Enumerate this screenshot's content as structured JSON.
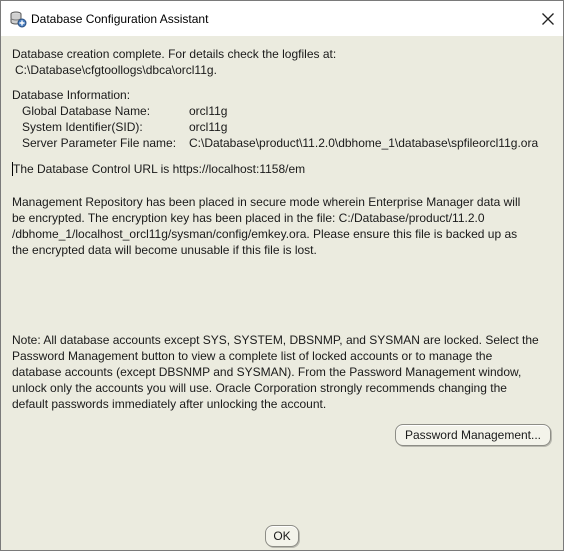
{
  "window": {
    "title": "Database Configuration Assistant",
    "icon": "database-config-icon",
    "close_icon": "close-icon"
  },
  "completion": {
    "line1": "Database creation complete. For details check the logfiles at:",
    "line2": "C:\\Database\\cfgtoollogs\\dbca\\orcl11g."
  },
  "db_info": {
    "heading": "Database Information:",
    "rows": [
      {
        "label": "Global Database Name:",
        "value": "orcl11g"
      },
      {
        "label": "System Identifier(SID):",
        "value": "orcl11g"
      },
      {
        "label": "Server Parameter File name:",
        "value": "C:\\Database\\product\\11.2.0\\dbhome_1\\database\\spfileorcl11g.ora"
      }
    ]
  },
  "control_url": "The Database Control URL is https://localhost:1158/em",
  "repository": {
    "lines": [
      "Management Repository has been placed in secure mode wherein Enterprise Manager data will",
      "be encrypted.  The encryption key has been placed in the file: C:/Database/product/11.2.0",
      "/dbhome_1/localhost_orcl11g/sysman/config/emkey.ora.   Please ensure this file is backed up as",
      "the encrypted data will become unusable if this file is lost."
    ]
  },
  "note": {
    "lines": [
      "Note: All database accounts except SYS, SYSTEM, DBSNMP, and SYSMAN are locked. Select the",
      "Password Management button to view a complete list of locked accounts or to manage the",
      "database accounts (except DBSNMP and SYSMAN). From the Password Management window,",
      "unlock only the accounts you will use. Oracle Corporation strongly recommends changing the",
      "default passwords immediately after unlocking the account."
    ]
  },
  "buttons": {
    "password_management": "Password Management...",
    "ok": "OK"
  },
  "colors": {
    "dialog_background": "#ebebdf",
    "titlebar_background": "#ffffff",
    "text": "#1a1a1a"
  }
}
